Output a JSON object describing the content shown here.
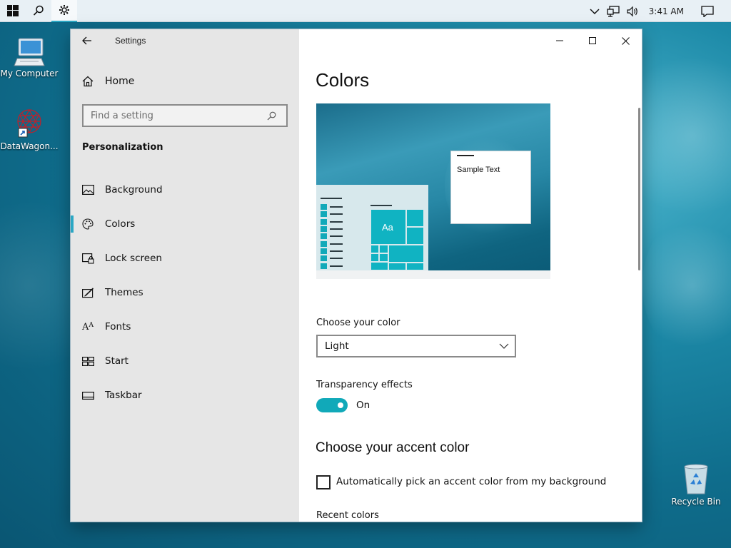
{
  "taskbar": {
    "clock": "3:41 AM",
    "accent": "#2aa7c4"
  },
  "desktop": {
    "icons": [
      {
        "label": "My Computer",
        "icon": "computer-icon"
      },
      {
        "label": "DataWagon...",
        "icon": "datawagon-icon"
      },
      {
        "label": "Recycle Bin",
        "icon": "recycle-bin-icon"
      }
    ]
  },
  "window": {
    "title": "Settings",
    "sidebar": {
      "home_label": "Home",
      "search_placeholder": "Find a setting",
      "section_title": "Personalization",
      "items": [
        {
          "label": "Background",
          "icon": "picture-icon"
        },
        {
          "label": "Colors",
          "icon": "palette-icon",
          "selected": true
        },
        {
          "label": "Lock screen",
          "icon": "lock-screen-icon"
        },
        {
          "label": "Themes",
          "icon": "themes-icon"
        },
        {
          "label": "Fonts",
          "icon": "fonts-icon"
        },
        {
          "label": "Start",
          "icon": "start-icon"
        },
        {
          "label": "Taskbar",
          "icon": "taskbar-icon"
        }
      ]
    },
    "main": {
      "page_title": "Colors",
      "preview": {
        "tile_label": "Aa",
        "sample_text": "Sample Text",
        "accent": "#11a9b9"
      },
      "choose_color_label": "Choose your color",
      "choose_color_value": "Light",
      "transparency_label": "Transparency effects",
      "transparency_state": "On",
      "accent_title": "Choose your accent color",
      "auto_pick_label": "Automatically pick an accent color from my background",
      "recent_colors_label": "Recent colors"
    }
  }
}
